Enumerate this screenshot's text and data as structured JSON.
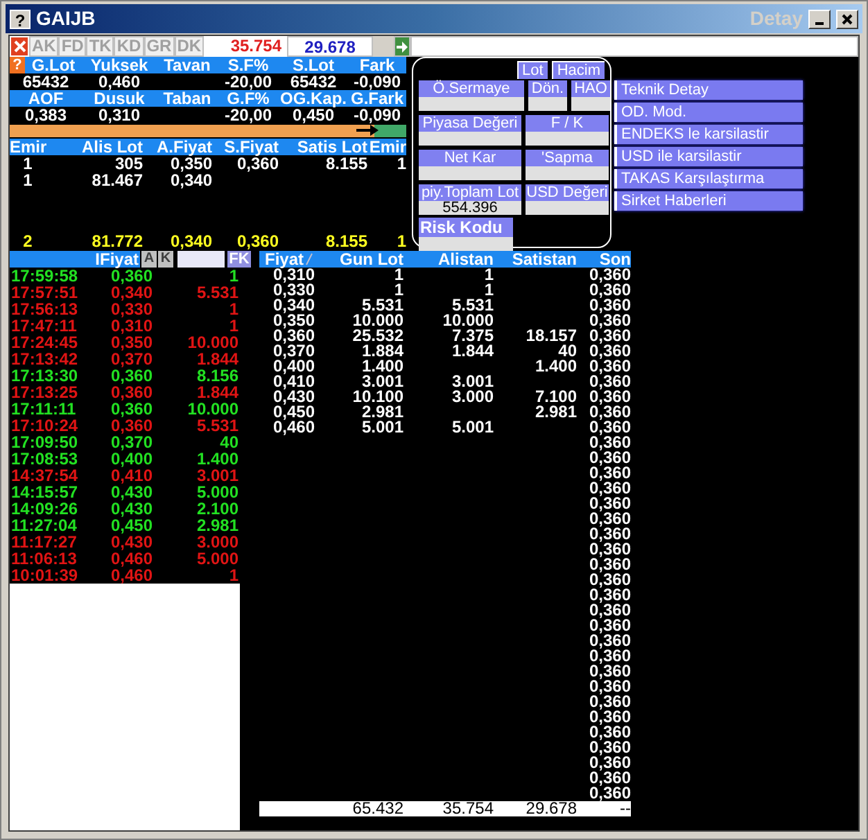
{
  "window": {
    "help_glyph": "?",
    "title": "GAIJB",
    "caption": "Detay"
  },
  "toolbar": {
    "tabs": [
      "AK",
      "FD",
      "TK",
      "KD",
      "GR",
      "DK"
    ],
    "bid_total": "35.754",
    "ask_total": "29.678"
  },
  "quote": {
    "help_glyph": "?",
    "rows": [
      [
        {
          "label": "G.Lot",
          "value": "65432"
        },
        {
          "label": "Yuksek",
          "value": "0,460"
        },
        {
          "label": "Tavan"
        },
        {
          "label": "S.F%",
          "value": "-20,00"
        },
        {
          "label": "S.Lot",
          "value": "65432"
        },
        {
          "label": "Fark",
          "value": "-0,090"
        }
      ],
      [
        {
          "label": "AOF",
          "value": "0,383"
        },
        {
          "label": "Dusuk",
          "value": "0,310"
        },
        {
          "label": "Taban"
        },
        {
          "label": "G.F%",
          "value": "-20,00"
        },
        {
          "label": "OG.Kap.",
          "value": "0,450"
        },
        {
          "label": "G.Fark",
          "value": "-0,090"
        }
      ]
    ],
    "balance": {
      "level": 0.92
    }
  },
  "order_book": {
    "columns": [
      "Emir",
      "Alis Lot",
      "A.Fiyat",
      "S.Fiyat",
      "Satis Lot",
      "Emir"
    ],
    "rows": [
      {
        "emir": "1",
        "alis_lot": "305",
        "a_fiyat": "0,350",
        "s_fiyat": "0,360",
        "satis_lot": "8.155",
        "emir_2": "1"
      },
      {
        "emir": "1",
        "alis_lot": "81.467",
        "a_fiyat": "0,340"
      }
    ],
    "total": {
      "emir": "2",
      "alis_lot": "81.772",
      "a_fiyat": "0,340",
      "s_fiyat": "0,360",
      "satis_lot": "8.155",
      "emir_2": "1"
    }
  },
  "detail_panel": {
    "units": [
      "Lot",
      "Hacim"
    ],
    "field_rows": [
      [
        {
          "label": "Ö.Sermaye"
        },
        {
          "label": "Dön."
        },
        {
          "label": "HAO"
        }
      ],
      [
        {
          "label": "Piyasa Değeri"
        },
        {
          "label": "F / K"
        }
      ],
      [
        {
          "label": "Net Kar"
        },
        {
          "label": "'Sapma"
        }
      ],
      [
        {
          "label": "piy.Toplam Lot",
          "value": "554.396"
        },
        {
          "label": "USD Değeri"
        }
      ]
    ],
    "risk": {
      "label": "Risk Kodu"
    }
  },
  "links": [
    "Teknik Detay",
    "OD. Mod.",
    "ENDEKS le karsilastir",
    "USD ile karsilastir",
    "TAKAS Karşılaştırma",
    "Sirket Haberleri"
  ],
  "trades": {
    "header": "IFiyat",
    "buttons": [
      "A",
      "K"
    ],
    "fk": "FK",
    "rows": [
      {
        "time": "17:59:58",
        "price": "0,360",
        "lot": "1",
        "color": "#22e022"
      },
      {
        "time": "17:57:51",
        "price": "0,340",
        "lot": "5.531",
        "color": "#e01414"
      },
      {
        "time": "17:56:13",
        "price": "0,330",
        "lot": "1",
        "color": "#e01414"
      },
      {
        "time": "17:47:11",
        "price": "0,310",
        "lot": "1",
        "color": "#e01414"
      },
      {
        "time": "17:24:45",
        "price": "0,350",
        "lot": "10.000",
        "color": "#e01414"
      },
      {
        "time": "17:13:42",
        "price": "0,370",
        "lot": "1.844",
        "color": "#e01414"
      },
      {
        "time": "17:13:30",
        "price": "0,360",
        "lot": "8.156",
        "color": "#22e022"
      },
      {
        "time": "17:13:25",
        "price": "0,360",
        "lot": "1.844",
        "color": "#e01414"
      },
      {
        "time": "17:11:11",
        "price": "0,360",
        "lot": "10.000",
        "color": "#22e022"
      },
      {
        "time": "17:10:24",
        "price": "0,360",
        "lot": "5.531",
        "color": "#e01414"
      },
      {
        "time": "17:09:50",
        "price": "0,370",
        "lot": "40",
        "color": "#22e022"
      },
      {
        "time": "17:08:53",
        "price": "0,400",
        "lot": "1.400",
        "color": "#22e022"
      },
      {
        "time": "14:37:54",
        "price": "0,410",
        "lot": "3.001",
        "color": "#e01414"
      },
      {
        "time": "14:15:57",
        "price": "0,430",
        "lot": "5.000",
        "color": "#22e022"
      },
      {
        "time": "14:09:26",
        "price": "0,430",
        "lot": "2.100",
        "color": "#22e022"
      },
      {
        "time": "11:27:04",
        "price": "0,450",
        "lot": "2.981",
        "color": "#22e022"
      },
      {
        "time": "11:17:27",
        "price": "0,430",
        "lot": "3.000",
        "color": "#e01414"
      },
      {
        "time": "11:06:13",
        "price": "0,460",
        "lot": "5.000",
        "color": "#e01414"
      },
      {
        "time": "10:01:39",
        "price": "0,460",
        "lot": "1",
        "color": "#e01414"
      }
    ]
  },
  "price_table": {
    "columns": [
      "Fiyat",
      "Gun Lot",
      "Alistan",
      "Satistan",
      "Son"
    ],
    "rows": [
      {
        "fiyat": "0,310",
        "gun_lot": "1",
        "alistan": "1",
        "son": "0,360"
      },
      {
        "fiyat": "0,330",
        "gun_lot": "1",
        "alistan": "1",
        "son": "0,360"
      },
      {
        "fiyat": "0,340",
        "gun_lot": "5.531",
        "alistan": "5.531",
        "son": "0,360"
      },
      {
        "fiyat": "0,350",
        "gun_lot": "10.000",
        "alistan": "10.000",
        "son": "0,360"
      },
      {
        "fiyat": "0,360",
        "gun_lot": "25.532",
        "alistan": "7.375",
        "satistan": "18.157",
        "son": "0,360"
      },
      {
        "fiyat": "0,370",
        "gun_lot": "1.884",
        "alistan": "1.844",
        "satistan": "40",
        "son": "0,360"
      },
      {
        "fiyat": "0,400",
        "gun_lot": "1.400",
        "satistan": "1.400",
        "son": "0,360"
      },
      {
        "fiyat": "0,410",
        "gun_lot": "3.001",
        "alistan": "3.001",
        "son": "0,360"
      },
      {
        "fiyat": "0,430",
        "gun_lot": "10.100",
        "alistan": "3.000",
        "satistan": "7.100",
        "son": "0,360"
      },
      {
        "fiyat": "0,450",
        "gun_lot": "2.981",
        "satistan": "2.981",
        "son": "0,360"
      },
      {
        "fiyat": "0,460",
        "gun_lot": "5.001",
        "alistan": "5.001",
        "son": "0,360"
      },
      {
        "son": "0,360"
      },
      {
        "son": "0,360"
      },
      {
        "son": "0,360"
      },
      {
        "son": "0,360"
      },
      {
        "son": "0,360"
      },
      {
        "son": "0,360"
      },
      {
        "son": "0,360"
      },
      {
        "son": "0,360"
      },
      {
        "son": "0,360"
      },
      {
        "son": "0,360"
      },
      {
        "son": "0,360"
      },
      {
        "son": "0,360"
      },
      {
        "son": "0,360"
      },
      {
        "son": "0,360"
      },
      {
        "son": "0,360"
      },
      {
        "son": "0,360"
      },
      {
        "son": "0,360"
      },
      {
        "son": "0,360"
      },
      {
        "son": "0,360"
      },
      {
        "son": "0,360"
      },
      {
        "son": "0,360"
      },
      {
        "son": "0,360"
      },
      {
        "son": "0,360"
      },
      {
        "son": "0,360"
      }
    ],
    "totals": {
      "gun_lot": "65.432",
      "alistan": "35.754",
      "satistan": "29.678",
      "son": "--"
    }
  }
}
